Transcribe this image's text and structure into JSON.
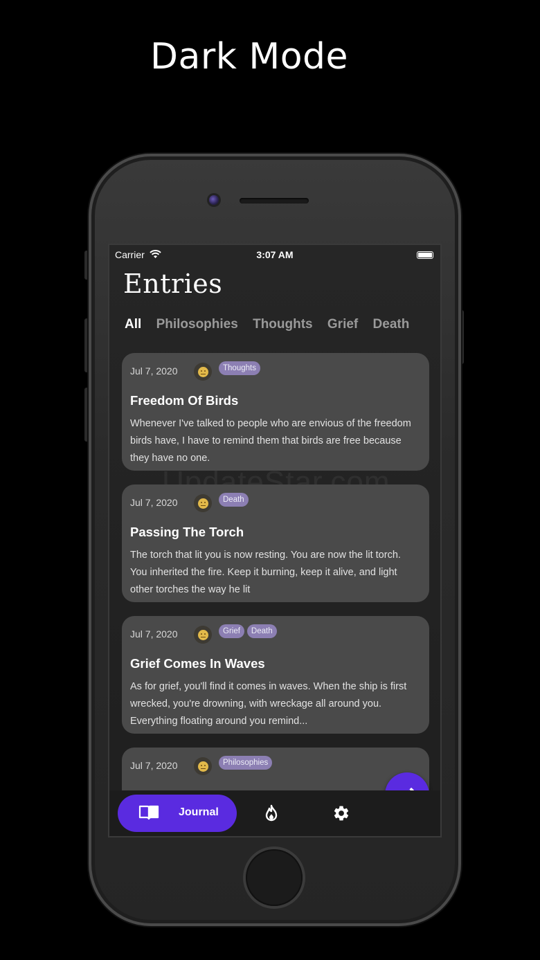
{
  "headline": "Dark Mode",
  "status_bar": {
    "carrier": "Carrier",
    "time": "3:07 AM"
  },
  "page_title": "Entries",
  "tabs": [
    {
      "label": "All",
      "active": true
    },
    {
      "label": "Philosophies",
      "active": false
    },
    {
      "label": "Thoughts",
      "active": false
    },
    {
      "label": "Grief",
      "active": false
    },
    {
      "label": "Death",
      "active": false
    }
  ],
  "entries": [
    {
      "date": "Jul 7, 2020",
      "mood": "neutral-face",
      "tags": [
        "Thoughts"
      ],
      "title": "Freedom Of Birds",
      "body": "Whenever I've talked to people who are envious of the freedom birds have, I have to remind them that birds are free because they have no one."
    },
    {
      "date": "Jul 7, 2020",
      "mood": "neutral-face",
      "tags": [
        "Death"
      ],
      "title": "Passing The Torch",
      "body": "The torch that lit you is now resting. You are now the lit torch. You inherited the fire. Keep it burning, keep it alive, and light other torches the way he lit"
    },
    {
      "date": "Jul 7, 2020",
      "mood": "neutral-face",
      "tags": [
        "Grief",
        "Death"
      ],
      "title": "Grief Comes In Waves",
      "body": "As for grief, you'll find it comes in waves. When the ship is first wrecked, you're drowning, with wreckage all around you. Everything floating around you remind..."
    },
    {
      "date": "Jul 7, 2020",
      "mood": "neutral-face",
      "tags": [
        "Philosophies"
      ],
      "title": "",
      "body": ""
    }
  ],
  "nav": {
    "journal_label": "Journal"
  },
  "icons": {
    "compose": "pencil-icon",
    "journal": "book-icon",
    "streak": "fire-icon",
    "settings": "gear-icon"
  },
  "colors": {
    "accent": "#5a2be0",
    "tag": "#8c7fb3",
    "card": "#4a4a4a"
  },
  "watermark": "UpdateStar.com"
}
